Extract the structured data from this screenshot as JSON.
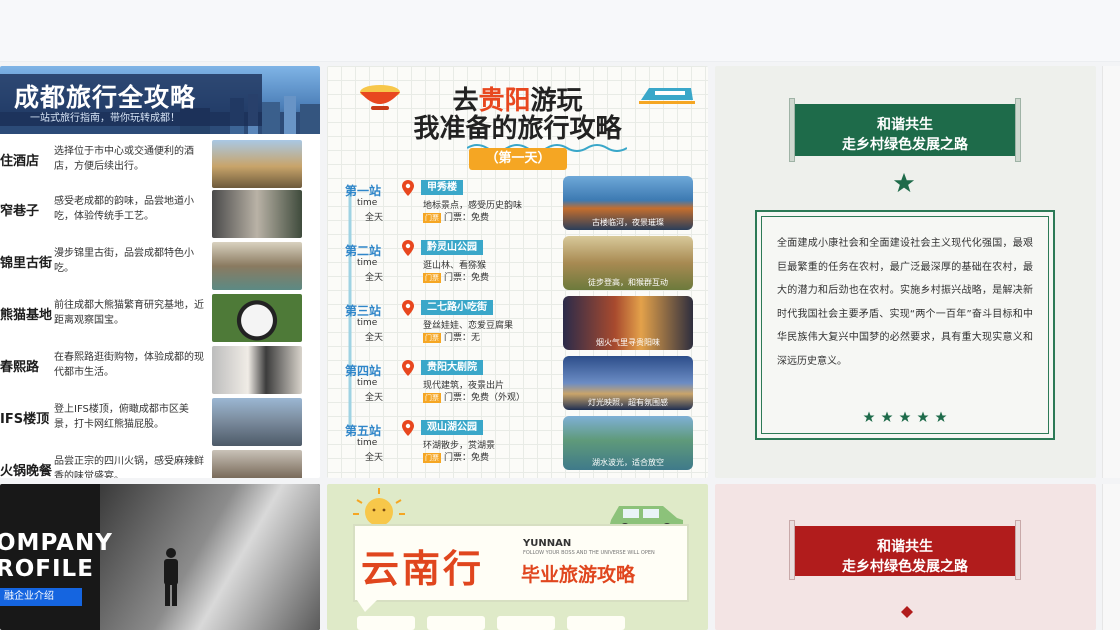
{
  "card1": {
    "title": "成都旅行全攻略",
    "subtitle": "一站式旅行指南，带你玩转成都！",
    "rows": [
      {
        "name": "住酒店",
        "desc": "选择位于市中心或交通便利的酒店，方便后续出行。"
      },
      {
        "name": "窄巷子",
        "desc": "感受老成都的韵味，品尝地道小吃，体验传统手工艺。"
      },
      {
        "name": "锦里古街",
        "desc": "漫步锦里古街，品尝成都特色小吃。"
      },
      {
        "name": "熊猫基地",
        "desc": "前往成都大熊猫繁育研究基地，近距离观察国宝。"
      },
      {
        "name": "春熙路",
        "desc": "在春熙路逛街购物，体验成都的现代都市生活。"
      },
      {
        "name": "IFS楼顶",
        "desc": "登上IFS楼顶，俯瞰成都市区美景，打卡网红熊猫屁股。"
      },
      {
        "name": "火锅晚餐",
        "desc": "品尝正宗的四川火锅，感受麻辣鲜香的味觉盛宴。"
      }
    ]
  },
  "card2": {
    "title_pre": "去",
    "title_hl": "贵阳",
    "title_post": "游玩",
    "title2": "我准备的旅行攻略",
    "day": "（第一天）",
    "time_label": "time",
    "all_day": "全天",
    "fee_tag": "门票",
    "stops": [
      {
        "station": "第一站",
        "place": "甲秀楼",
        "info": "地标景点，感受历史韵味",
        "fee": "门票：免费",
        "caption": "古楼临河，夜景璀璨"
      },
      {
        "station": "第二站",
        "place": "黔灵山公园",
        "info": "逛山林、看猕猴",
        "fee": "门票：免费",
        "caption": "徒步登高，和猴群互动"
      },
      {
        "station": "第三站",
        "place": "二七路小吃街",
        "info": "登丝娃娃、恋爱豆腐果",
        "fee": "门票：无",
        "caption": "烟火气里寻贵阳味"
      },
      {
        "station": "第四站",
        "place": "贵阳大剧院",
        "info": "现代建筑，夜景出片",
        "fee": "门票：免费（外观）",
        "caption": "灯光映照，超有氛围感"
      },
      {
        "station": "第五站",
        "place": "观山湖公园",
        "info": "环湖散步，赏湖景",
        "fee": "门票：免费",
        "caption": "湖水波光，适合放空"
      }
    ]
  },
  "card3": {
    "banner_line1": "和谐共生",
    "banner_line2": "走乡村绿色发展之路",
    "body": "全面建成小康社会和全面建设社会主义现代化强国，最艰巨最繁重的任务在农村，最广泛最深厚的基础在农村，最大的潜力和后劲也在农村。实施乡村振兴战略，是解决新时代我国社会主要矛盾、实现“两个一百年”奋斗目标和中华民族伟大复兴中国梦的必然要求，具有重大现实意义和深远历史意义。",
    "stars": 5
  },
  "card4": {
    "line1": "OMPANY",
    "line2": "ROFILE",
    "tag": "融企业介绍"
  },
  "card5": {
    "title": "云南行",
    "english": "YUNNAN",
    "tiny": "FOLLOW YOUR BOSS AND THE UNIVERSE WILL OPEN",
    "subtitle": "毕业旅游攻略"
  },
  "card6": {
    "banner_line1": "和谐共生",
    "banner_line2": "走乡村绿色发展之路"
  },
  "colors": {
    "green": "#1e6b4a",
    "red": "#b11c1c",
    "orange": "#e0461e",
    "blue_tag": "#3aa7c9",
    "accent_yellow": "#f5a623"
  }
}
